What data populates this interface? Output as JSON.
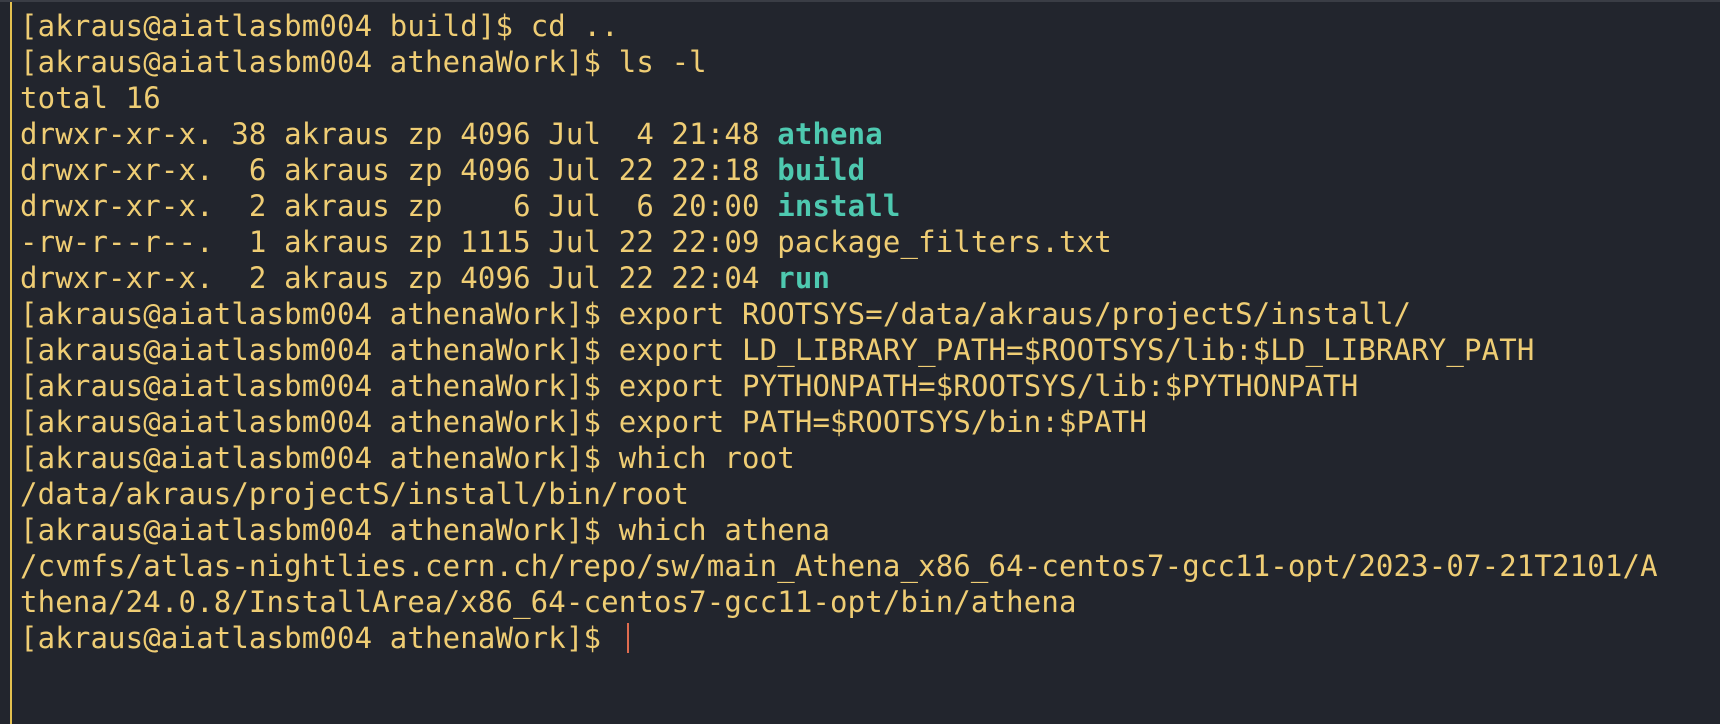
{
  "colors": {
    "background": "#22252d",
    "text": "#efcd74",
    "directory": "#4ec9b0",
    "cursor": "#e06c4f",
    "left_bar": "#e3c04f"
  },
  "terminal": {
    "prompt_build": "[akraus@aiatlasbm004 build]$ ",
    "prompt": "[akraus@aiatlasbm004 athenaWork]$ ",
    "lines": [
      {
        "type": "cmd_build",
        "cmd": "cd .."
      },
      {
        "type": "cmd",
        "cmd": "ls -l"
      },
      {
        "type": "out",
        "text": "total 16"
      },
      {
        "type": "ls",
        "meta": "drwxr-xr-x. 38 akraus zp 4096 Jul  4 21:48 ",
        "name": "athena",
        "is_dir": true
      },
      {
        "type": "ls",
        "meta": "drwxr-xr-x.  6 akraus zp 4096 Jul 22 22:18 ",
        "name": "build",
        "is_dir": true
      },
      {
        "type": "ls",
        "meta": "drwxr-xr-x.  2 akraus zp    6 Jul  6 20:00 ",
        "name": "install",
        "is_dir": true
      },
      {
        "type": "ls",
        "meta": "-rw-r--r--.  1 akraus zp 1115 Jul 22 22:09 ",
        "name": "package_filters.txt",
        "is_dir": false
      },
      {
        "type": "ls",
        "meta": "drwxr-xr-x.  2 akraus zp 4096 Jul 22 22:04 ",
        "name": "run",
        "is_dir": true
      },
      {
        "type": "cmd",
        "cmd": "export ROOTSYS=/data/akraus/projectS/install/"
      },
      {
        "type": "cmd",
        "cmd": "export LD_LIBRARY_PATH=$ROOTSYS/lib:$LD_LIBRARY_PATH"
      },
      {
        "type": "cmd",
        "cmd": "export PYTHONPATH=$ROOTSYS/lib:$PYTHONPATH"
      },
      {
        "type": "cmd",
        "cmd": "export PATH=$ROOTSYS/bin:$PATH"
      },
      {
        "type": "cmd",
        "cmd": "which root"
      },
      {
        "type": "out",
        "text": "/data/akraus/projectS/install/bin/root"
      },
      {
        "type": "cmd",
        "cmd": "which athena"
      },
      {
        "type": "out",
        "text": "/cvmfs/atlas-nightlies.cern.ch/repo/sw/main_Athena_x86_64-centos7-gcc11-opt/2023-07-21T2101/A"
      },
      {
        "type": "out",
        "text": "thena/24.0.8/InstallArea/x86_64-centos7-gcc11-opt/bin/athena"
      },
      {
        "type": "active",
        "cmd": ""
      }
    ]
  }
}
